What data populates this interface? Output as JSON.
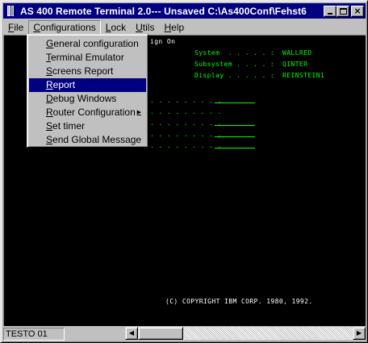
{
  "window": {
    "title": "AS 400 Remote Terminal 2.0--- Unsaved C:\\As400Conf\\Fehst6",
    "controls": {
      "minimize": "_",
      "maximize": "□",
      "close": "×"
    }
  },
  "menubar": {
    "items": [
      {
        "label": "File",
        "underline": "F"
      },
      {
        "label": "Configurations",
        "underline": "C"
      },
      {
        "label": "Lock",
        "underline": "L"
      },
      {
        "label": "Utils",
        "underline": "U"
      },
      {
        "label": "Help",
        "underline": "H"
      }
    ],
    "open_menu": "Configurations"
  },
  "configurations_menu": {
    "items": [
      {
        "label": "General configuration",
        "selected": false,
        "submenu": false
      },
      {
        "label": "Terminal Emulator",
        "selected": false,
        "submenu": false
      },
      {
        "label": "Screens Report",
        "selected": false,
        "submenu": false
      },
      {
        "label": "Report",
        "selected": true,
        "submenu": false
      },
      {
        "label": "Debug Windows",
        "selected": false,
        "submenu": false
      },
      {
        "label": "Router Configuration",
        "selected": false,
        "submenu": true
      },
      {
        "label": "Set timer",
        "selected": false,
        "submenu": false
      },
      {
        "label": "Send Global Message",
        "selected": false,
        "submenu": false
      }
    ],
    "submenu_arrow": "▶"
  },
  "terminal": {
    "screen_title": "ign On",
    "info": [
      {
        "label": "System  . . . . . :",
        "value": "WALLRED"
      },
      {
        "label": "Subsystem . . . . :",
        "value": "QINTER"
      },
      {
        "label": "Display . . . . . :",
        "value": "REINSTEIN1"
      }
    ],
    "prompt_dots": [
      ". . . . . . . . .",
      ". . . . . . . . .",
      ". . . . . . . . .",
      ". . . . . . . . .",
      ". . . . . . . . ."
    ],
    "copyright": "(C) COPYRIGHT IBM CORP. 1980, 1992.",
    "colors": {
      "background": "#000000",
      "text": "#00ff00",
      "copyright": "#ffffff"
    }
  },
  "statusbar": {
    "session": "TESTO 01",
    "scroll_left": "◀",
    "scroll_right": "▶"
  },
  "colors": {
    "titlebar": "#000080",
    "face": "#c0c0c0",
    "highlight": "#000080"
  }
}
